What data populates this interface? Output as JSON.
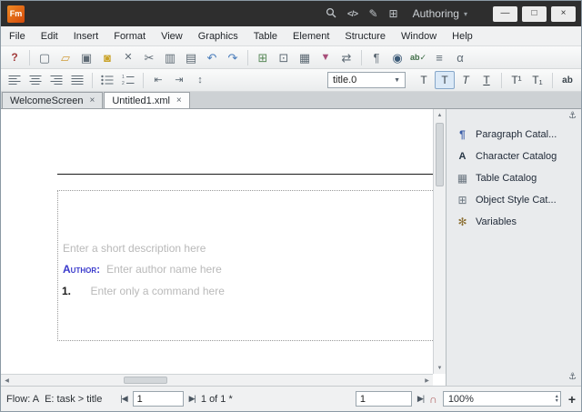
{
  "titlebar": {
    "app": "Fm",
    "mode": "Authoring",
    "caret": "▾",
    "icons": {
      "code": "</>",
      "pen": "✎",
      "pod": "⊞"
    },
    "window_buttons": {
      "minimize": "—",
      "maximize": "□",
      "close": "×"
    }
  },
  "menubar": {
    "items": [
      "File",
      "Edit",
      "Insert",
      "Format",
      "View",
      "Graphics",
      "Table",
      "Element",
      "Structure",
      "Window",
      "Help"
    ]
  },
  "toolbar_main": {
    "icons": [
      {
        "name": "help-icon",
        "glyph": "?"
      },
      {
        "name": "new-document-icon",
        "glyph": "▢"
      },
      {
        "name": "open-folder-icon",
        "glyph": "▱"
      },
      {
        "name": "save-icon",
        "glyph": "▣"
      },
      {
        "name": "lock-icon",
        "glyph": "◙"
      },
      {
        "name": "delete-icon",
        "glyph": "✕"
      },
      {
        "name": "cut-icon",
        "glyph": "✂"
      },
      {
        "name": "copy-icon",
        "glyph": "▥"
      },
      {
        "name": "paste-icon",
        "glyph": "▤"
      },
      {
        "name": "undo-icon",
        "glyph": "↶"
      },
      {
        "name": "redo-icon",
        "glyph": "↷"
      },
      {
        "name": "quick-element-icon",
        "glyph": "⊞"
      },
      {
        "name": "anchored-frame-icon",
        "glyph": "⊡"
      },
      {
        "name": "insert-table-icon",
        "glyph": "▦"
      },
      {
        "name": "marker-icon",
        "glyph": "▼"
      },
      {
        "name": "cross-reference-icon",
        "glyph": "⇄"
      },
      {
        "name": "paragraph-marks-icon",
        "glyph": "¶"
      },
      {
        "name": "find-icon",
        "glyph": "◉"
      },
      {
        "name": "spell-check-icon",
        "glyph": "ab✓"
      },
      {
        "name": "thesaurus-icon",
        "glyph": "≡"
      },
      {
        "name": "character-palette-icon",
        "glyph": "α"
      }
    ]
  },
  "toolbar_format": {
    "align_icons": [
      "align-left-icon",
      "align-center-icon",
      "align-right-icon",
      "align-justify-icon",
      "bullet-list-icon",
      "numbered-list-icon"
    ],
    "indent_decrease": "⇤",
    "indent_increase": "⇥",
    "line_spacing": "↕",
    "style_value": "title.0",
    "caret": "▼",
    "buttons": [
      {
        "name": "plain-text-button",
        "glyph": "T"
      },
      {
        "name": "bold-button",
        "glyph": "T",
        "active": true
      },
      {
        "name": "italic-button",
        "glyph": "T"
      },
      {
        "name": "underline-button",
        "glyph": "T"
      },
      {
        "name": "superscript-button",
        "glyph": "T¹"
      },
      {
        "name": "subscript-button",
        "glyph": "T₁"
      },
      {
        "name": "smallcaps-button",
        "glyph": "ab"
      }
    ]
  },
  "tabs": [
    {
      "label": "WelcomeScreen",
      "close": "×",
      "active": false
    },
    {
      "label": "Untitled1.xml",
      "close": "×",
      "active": true
    }
  ],
  "document": {
    "description_placeholder": "Enter a short description here",
    "author_label": "Author:",
    "author_placeholder": "Enter author name here",
    "step_number": "1.",
    "step_placeholder": "Enter only a command here"
  },
  "right_panel": {
    "anchor": "⚓",
    "items": [
      {
        "name": "paragraph-catalog",
        "icon": "¶",
        "label": "Paragraph Catal..."
      },
      {
        "name": "character-catalog",
        "icon": "A",
        "label": "Character Catalog"
      },
      {
        "name": "table-catalog",
        "icon": "▦",
        "label": "Table Catalog"
      },
      {
        "name": "object-style-catalog",
        "icon": "⊞",
        "label": "Object Style Cat..."
      },
      {
        "name": "variables",
        "icon": "✻",
        "label": "Variables"
      }
    ]
  },
  "scrollbars": {
    "up": "▲",
    "down": "▼",
    "left": "◀",
    "right": "▶"
  },
  "statusbar": {
    "flow": "Flow: A",
    "element_path": "E: task > title",
    "prev": "|◀",
    "next": "▶|",
    "page_value": "1",
    "page_count": "1 of 1 *",
    "line_value": "1",
    "go": "▶|",
    "magnet": "∩",
    "zoom": "100%",
    "spin_up": "▴",
    "spin_down": "▾",
    "add": "+"
  }
}
